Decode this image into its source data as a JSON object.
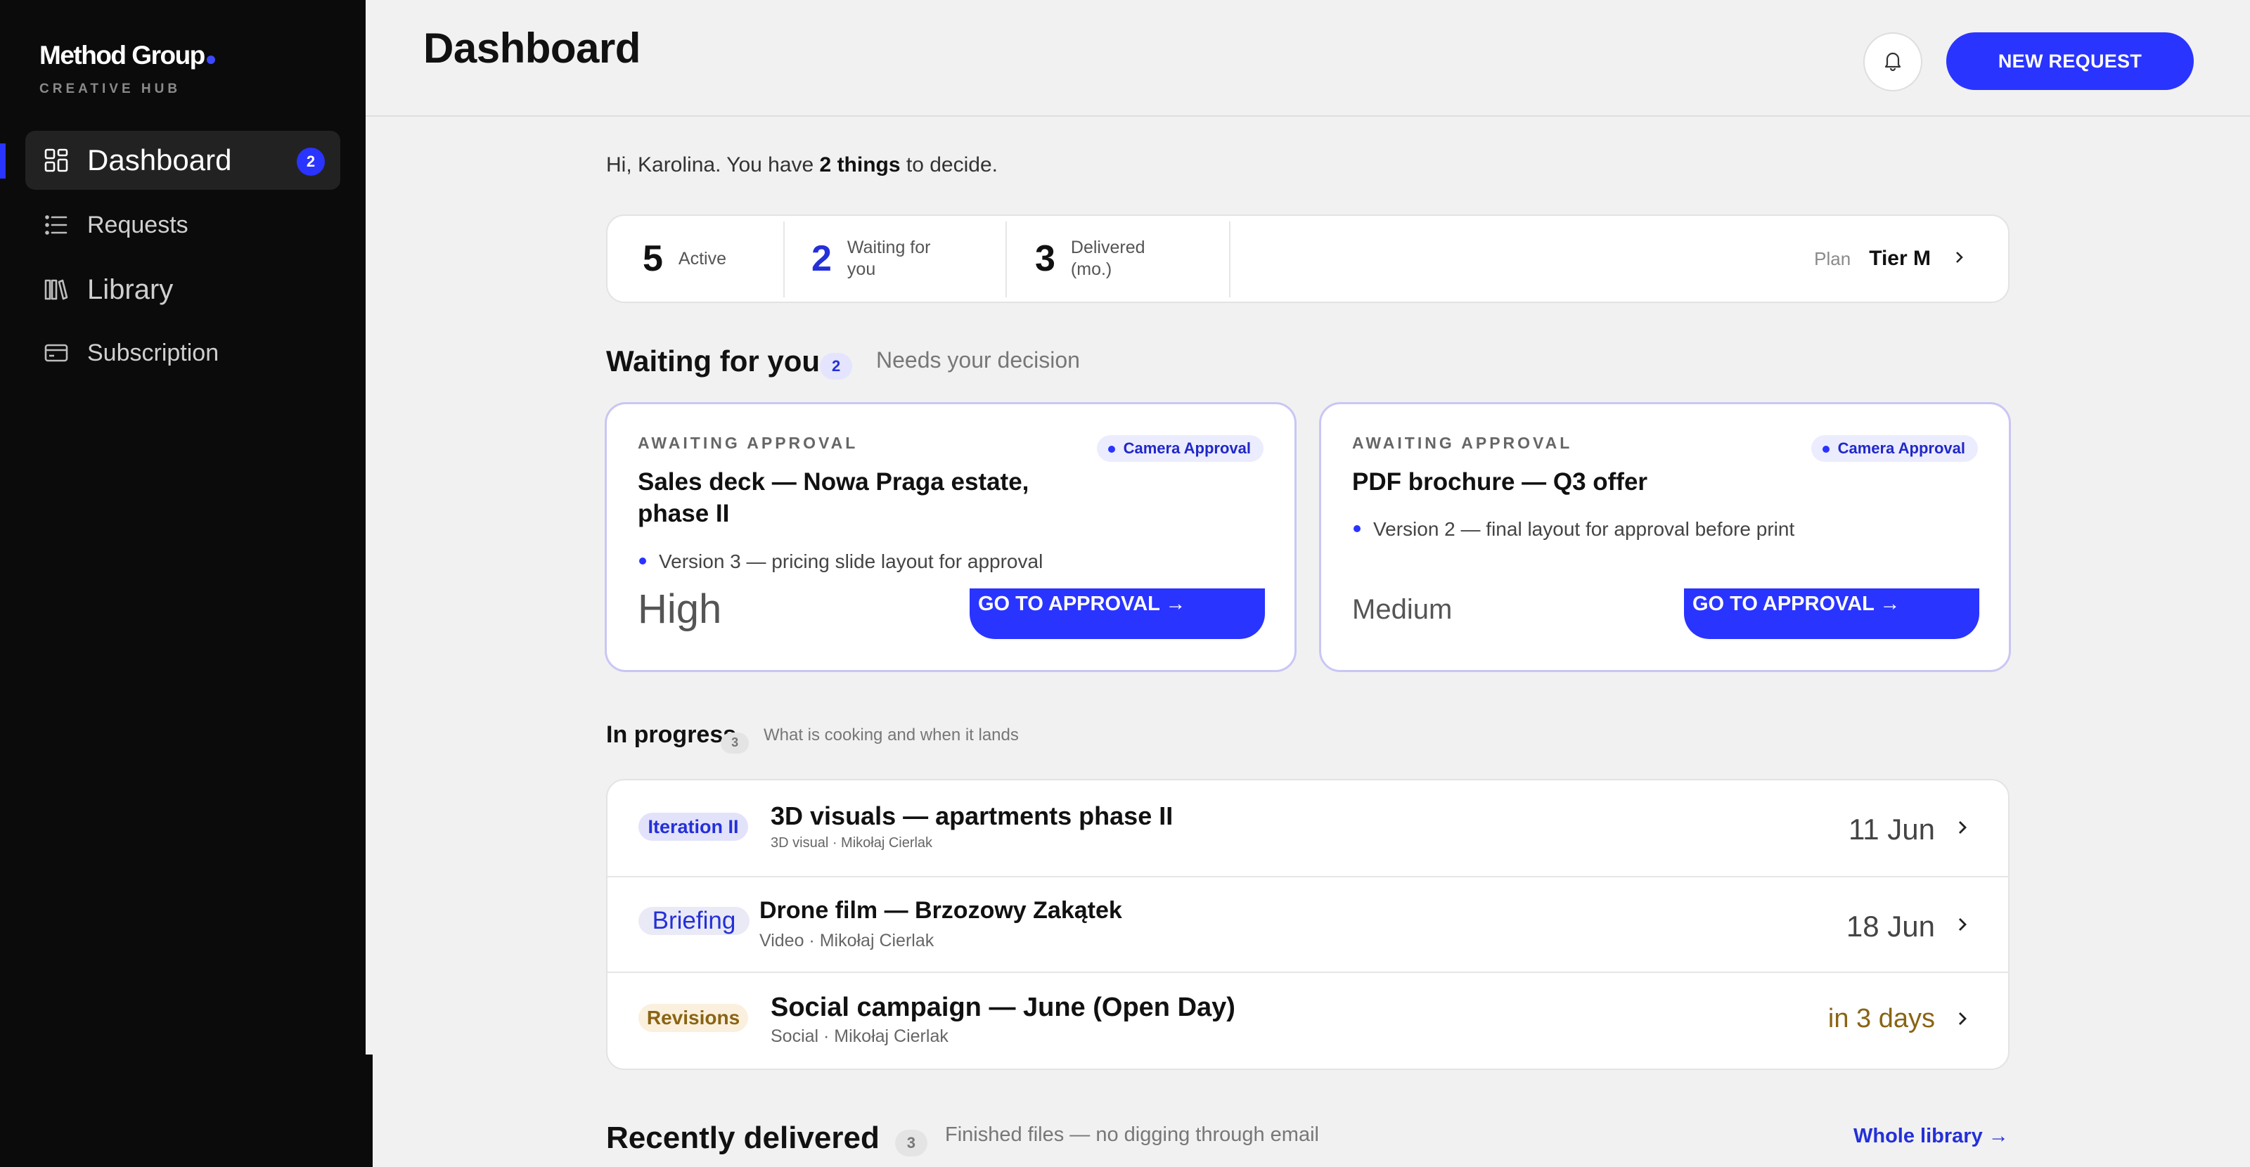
{
  "brand": {
    "name": "Method Group",
    "subtitle": "CREATIVE HUB"
  },
  "sidebar": {
    "items": [
      {
        "label": "Dashboard",
        "icon": "grid-icon",
        "active": true,
        "badge": "2"
      },
      {
        "label": "Requests",
        "icon": "list-icon"
      },
      {
        "label": "Library",
        "icon": "books-icon"
      },
      {
        "label": "Subscription",
        "icon": "card-icon"
      }
    ]
  },
  "header": {
    "title": "Dashboard",
    "new_request_label": "NEW REQUEST"
  },
  "greeting": {
    "prefix": "Hi, Karolina. You have ",
    "highlight": "2 things",
    "suffix": " to decide."
  },
  "stats": [
    {
      "value": "5",
      "label": "Active"
    },
    {
      "value": "2",
      "label": "Waiting for you"
    },
    {
      "value": "3",
      "label": "Delivered (mo.)"
    }
  ],
  "plan": {
    "label": "Plan",
    "value": "Tier M"
  },
  "waiting": {
    "title": "Waiting for you",
    "count": "2",
    "subtitle": "Needs your decision",
    "cards": [
      {
        "eyebrow": "AWAITING APPROVAL",
        "tag": "Camera Approval",
        "title": "Sales deck — Nowa Praga estate, phase II",
        "note": "Version 3 — pricing slide layout for approval",
        "priority": "High",
        "cta": "GO TO APPROVAL →"
      },
      {
        "eyebrow": "AWAITING APPROVAL",
        "tag": "Camera Approval",
        "title": "PDF brochure — Q3 offer",
        "note": "Version 2 — final layout for approval before print",
        "priority": "Medium",
        "cta": "GO TO APPROVAL →"
      }
    ]
  },
  "in_progress": {
    "title": "In progress",
    "count": "3",
    "subtitle": "What is cooking and when it lands",
    "rows": [
      {
        "stage": "Iteration II",
        "title": "3D visuals — apartments phase II",
        "meta": "3D visual · Mikołaj Cierlak",
        "date": "11 Jun"
      },
      {
        "stage": "Briefing",
        "title": "Drone film — Brzozowy Zakątek",
        "meta": "Video · Mikołaj Cierlak",
        "date": "18 Jun"
      },
      {
        "stage": "Revisions",
        "title": "Social campaign — June (Open Day)",
        "meta": "Social · Mikołaj Cierlak",
        "date": "in 3 days"
      }
    ]
  },
  "recently_delivered": {
    "title": "Recently delivered",
    "count": "3",
    "subtitle": "Finished files — no digging through email",
    "link": "Whole library →"
  },
  "colors": {
    "accent": "#2a34ff",
    "sidebar": "#0b0b0b",
    "warning_text": "#8a6414",
    "page": "#f1f1f1"
  }
}
